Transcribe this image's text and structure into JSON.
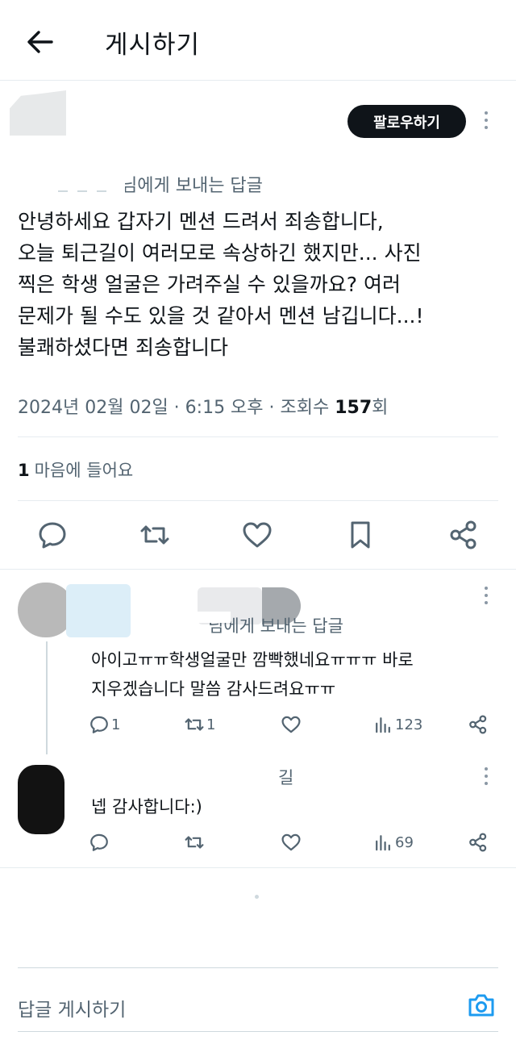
{
  "header": {
    "title": "게시하기"
  },
  "main_tweet": {
    "follow_label": "팔로우하기",
    "reply_to": "님에게 보내는 답글",
    "body_lines": [
      "안녕하세요 갑자기 멘션 드려서 죄송합니다,",
      "오늘 퇴근길이 여러모로 속상하긴 했지만... 사진",
      "찍은 학생 얼굴은 가려주실 수 있을까요? 여러",
      "문제가 될 수도 있을 것 같아서 멘션 남깁니다...!",
      "불쾌하셨다면 죄송합니다"
    ],
    "meta_prefix": "2024년 02월 02일 · 6:15 오후 · 조회수 ",
    "views": "157",
    "meta_suffix": "회",
    "likes_count": "1",
    "likes_label": "마음에 들어요"
  },
  "replies": [
    {
      "reply_to": "님에게 보내는 답글",
      "lines": [
        "아이고ㅠㅠ학생얼굴만 깜빡했네요ㅠㅠㅠ 바로",
        "지우겠습니다 말씀 감사드려요ㅠㅠ"
      ],
      "comments": "1",
      "retweets": "1",
      "views": "123"
    },
    {
      "name_fragment": "길",
      "lines": [
        "넵 감사합니다:)"
      ],
      "views": "69"
    }
  ],
  "composer": {
    "placeholder": "답글 게시하기"
  },
  "icons": {
    "back": "arrow-left-icon",
    "more": "more-vertical-icon",
    "reply": "comment-icon",
    "retweet": "retweet-icon",
    "like": "heart-icon",
    "bookmark": "bookmark-icon",
    "share": "share-icon",
    "views": "bar-chart-icon",
    "camera": "camera-icon"
  },
  "colors": {
    "accent": "#1d9bf0",
    "text": "#0f1419",
    "secondary": "#536471"
  }
}
